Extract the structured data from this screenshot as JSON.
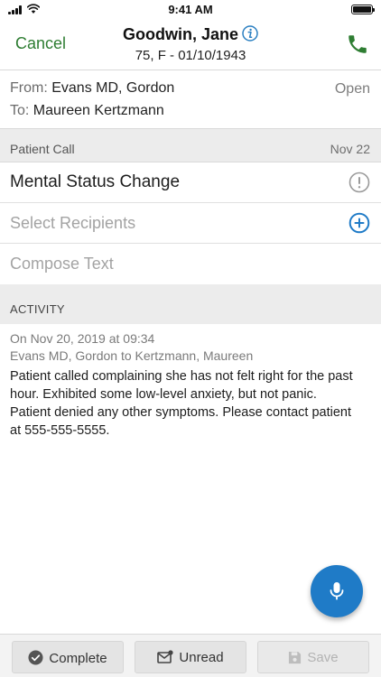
{
  "status_bar": {
    "time": "9:41 AM"
  },
  "header": {
    "cancel_label": "Cancel",
    "patient_name": "Goodwin, Jane",
    "patient_details": "75, F - 01/10/1943"
  },
  "message": {
    "from_label": "From:",
    "from_value": "Evans MD, Gordon",
    "to_label": "To:",
    "to_value": "Maureen Kertzmann",
    "status": "Open"
  },
  "category": {
    "label": "Patient Call",
    "date": "Nov 22"
  },
  "subject": {
    "text": "Mental Status Change"
  },
  "recipients": {
    "placeholder": "Select Recipients"
  },
  "compose": {
    "placeholder": "Compose Text"
  },
  "activity": {
    "header": "ACTIVITY",
    "entries": [
      {
        "date": "On Nov 20, 2019 at 09:34",
        "route": "Evans MD, Gordon to Kertzmann, Maureen",
        "body": "Patient called complaining she has not felt right for the past hour. Exhibited some low-level anxiety, but not panic. Patient denied any other symptoms. Please contact patient at 555-555-5555."
      }
    ]
  },
  "toolbar": {
    "complete_label": "Complete",
    "unread_label": "Unread",
    "save_label": "Save"
  },
  "colors": {
    "accent_green": "#2e7d32",
    "accent_blue": "#1f7bc7",
    "info_blue": "#2a7fc1"
  },
  "icons": {
    "info": "info-icon",
    "phone": "phone-icon",
    "alert": "alert-circle-icon",
    "add": "add-circle-icon",
    "mic": "microphone-icon",
    "complete": "check-circle-icon",
    "unread": "mail-icon",
    "save": "floppy-disk-icon"
  }
}
